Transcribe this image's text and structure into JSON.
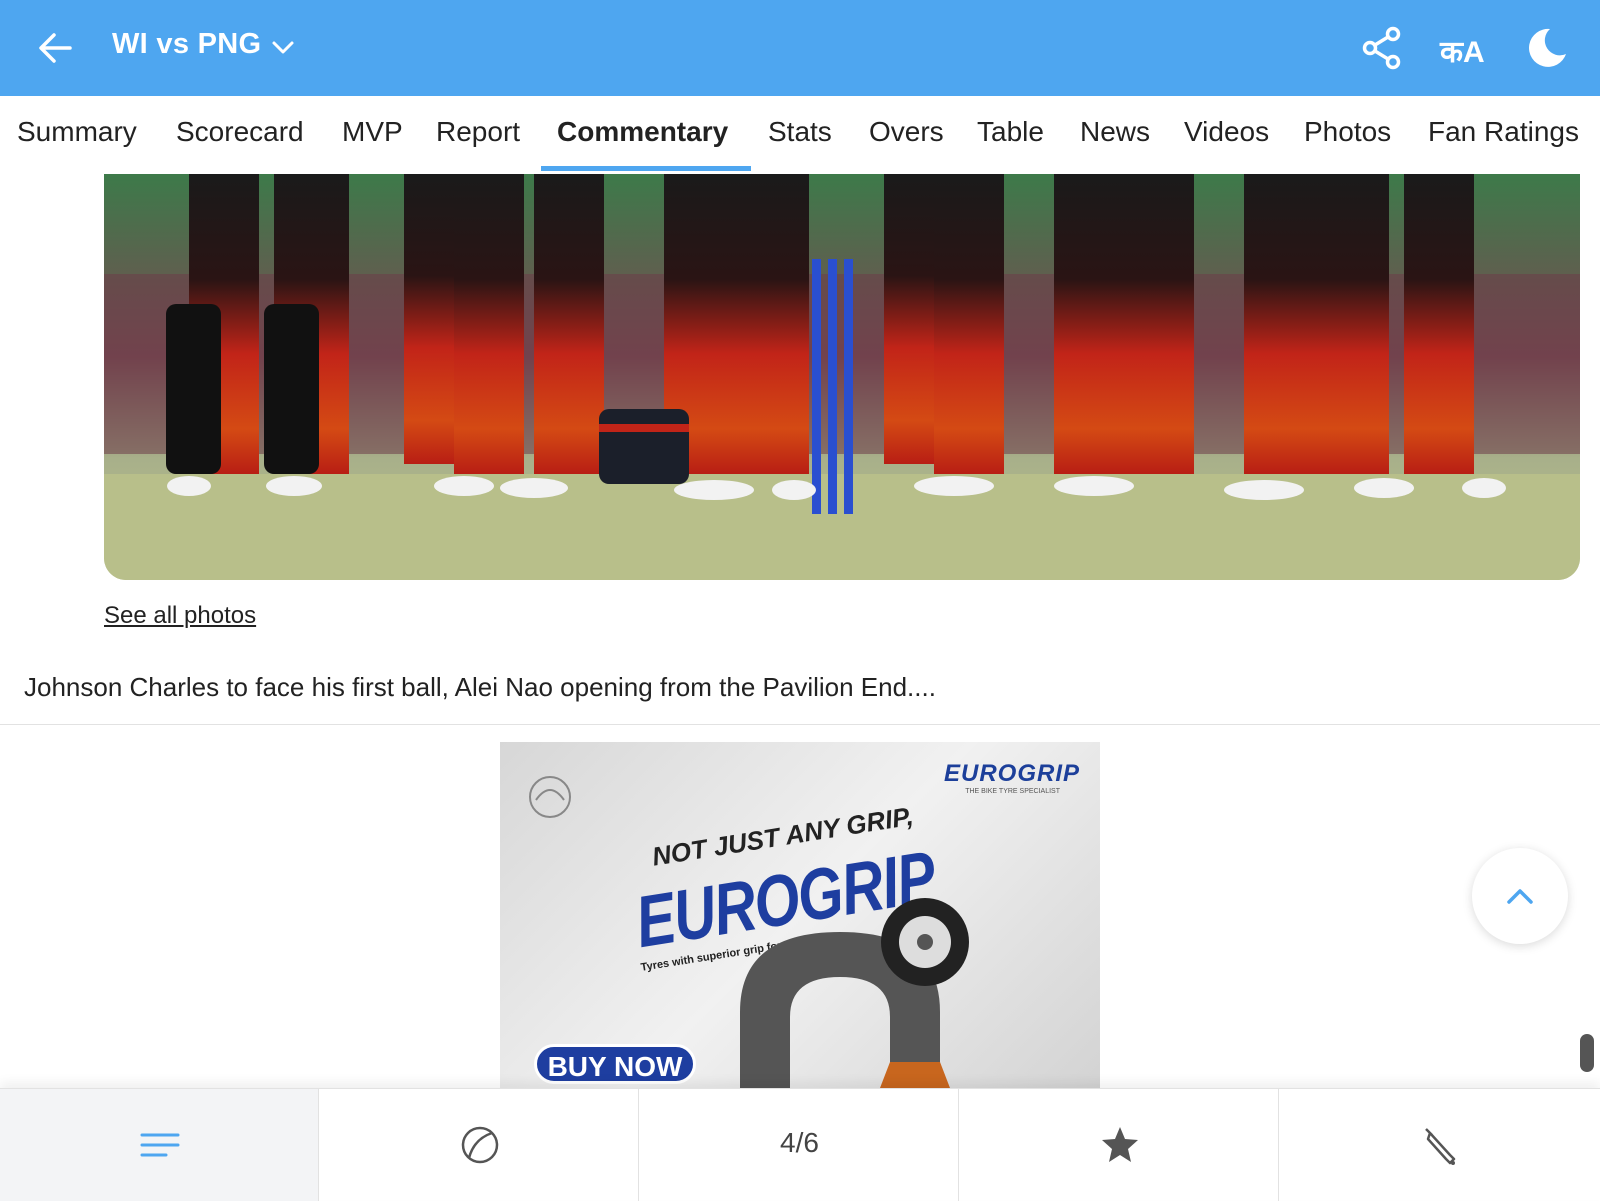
{
  "header": {
    "title": "WI vs PNG",
    "lang_label": "कA"
  },
  "tabs": [
    {
      "label": "Summary"
    },
    {
      "label": "Scorecard"
    },
    {
      "label": "MVP"
    },
    {
      "label": "Report"
    },
    {
      "label": "Commentary",
      "active": true
    },
    {
      "label": "Stats"
    },
    {
      "label": "Overs"
    },
    {
      "label": "Table"
    },
    {
      "label": "News"
    },
    {
      "label": "Videos"
    },
    {
      "label": "Photos"
    },
    {
      "label": "Fan Ratings"
    }
  ],
  "content": {
    "see_all_photos": "See all photos",
    "commentary_text": "Johnson Charles to face his first ball, Alei Nao opening from the Pavilion End...."
  },
  "ad": {
    "brand": "EUROGRIP",
    "brand_sub": "THE BIKE TYRE SPECIALIST",
    "headline": "NOT JUST ANY GRIP,",
    "big": "EUROGRIP",
    "tagline": "Tyres with superior grip for solid turns",
    "cta": "BUY NOW"
  },
  "bottom_nav": {
    "items": [
      "menu-icon",
      "ball-icon",
      "count",
      "star-icon",
      "bat-icon"
    ],
    "count": "4/6"
  },
  "colors": {
    "header_bg": "#4ea6f0",
    "accent": "#4ea6f0"
  }
}
